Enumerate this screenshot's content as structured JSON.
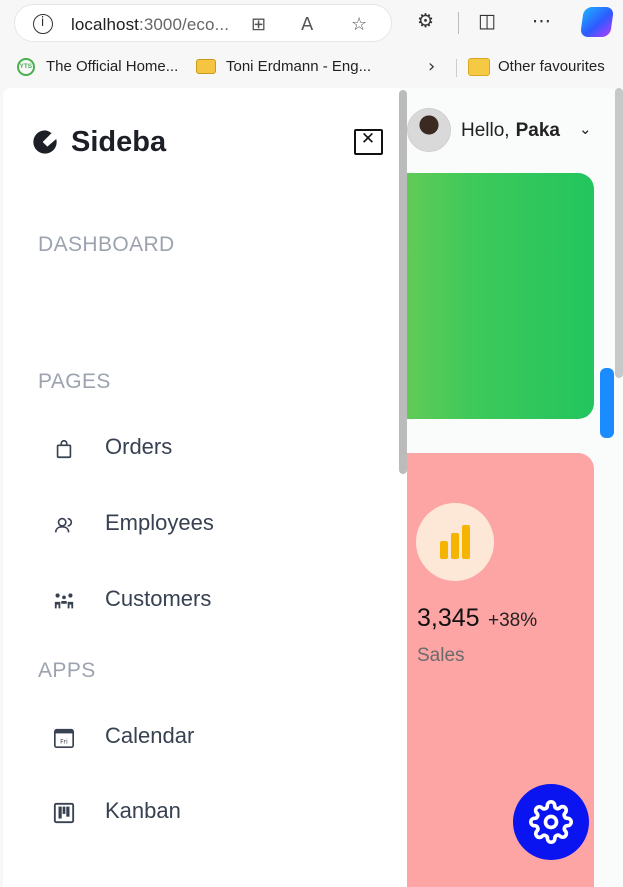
{
  "browser": {
    "url_main": "localhost",
    "url_rest": ":3000/eco...",
    "bookmarks": [
      {
        "label": "The Official Home..."
      },
      {
        "label": "Toni Erdmann - Eng..."
      }
    ],
    "other_favourites": "Other favourites"
  },
  "sidebar": {
    "logo_text": "Sideba",
    "sections": {
      "dashboard": "DASHBOARD",
      "pages": "PAGES",
      "apps": "APPS"
    },
    "pages_items": [
      {
        "label": "Orders",
        "icon": "shopping-bag-icon"
      },
      {
        "label": "Employees",
        "icon": "people-icon"
      },
      {
        "label": "Customers",
        "icon": "customers-icon"
      }
    ],
    "apps_items": [
      {
        "label": "Calendar",
        "icon": "calendar-icon"
      },
      {
        "label": "Kanban",
        "icon": "kanban-icon"
      }
    ],
    "calendar_icon_text": "Fri"
  },
  "header": {
    "greeting": "Hello,",
    "user_name": "Paka"
  },
  "cards": {
    "sales": {
      "value": "3,345",
      "change": "+38%",
      "label": "Sales"
    }
  },
  "colors": {
    "green_card": "#22c55e",
    "sales_card": "#fda4a4",
    "settings_button": "#0a14f0",
    "coin_icon": "#f5b400"
  }
}
